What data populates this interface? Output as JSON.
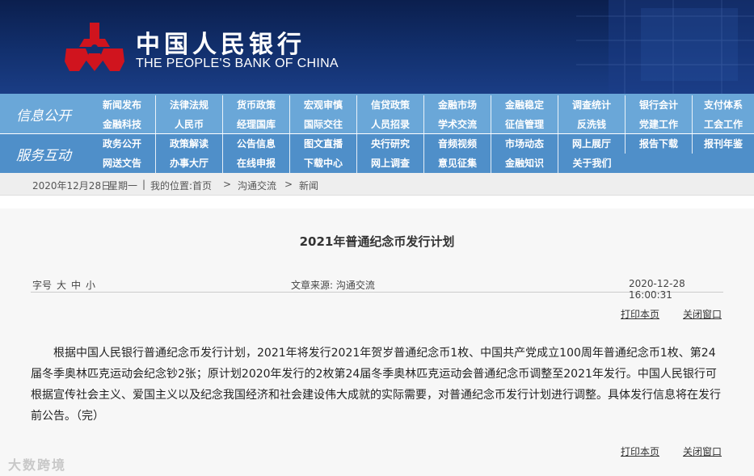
{
  "header": {
    "bank_name_cn": "中国人民银行",
    "bank_name_en": "THE PEOPLE'S BANK OF CHINA",
    "logo_icon": "pboc-logo-icon",
    "colors": {
      "banner": "#12306e",
      "logo": "#d0141e"
    }
  },
  "nav": {
    "info_title": "信息公开",
    "service_title": "服务互动",
    "info_row1": [
      "新闻发布",
      "法律法规",
      "货币政策",
      "宏观审慎",
      "信贷政策",
      "金融市场",
      "金融稳定",
      "调查统计",
      "银行会计",
      "支付体系"
    ],
    "info_row2": [
      "金融科技",
      "人民币",
      "经理国库",
      "国际交往",
      "人员招录",
      "学术交流",
      "征信管理",
      "反洗钱",
      "党建工作",
      "工会工作"
    ],
    "service_row1": [
      "政务公开",
      "政策解读",
      "公告信息",
      "图文直播",
      "央行研究",
      "音频视频",
      "市场动态",
      "网上展厅",
      "报告下载",
      "报刊年鉴"
    ],
    "service_row2": [
      "网送文告",
      "办事大厅",
      "在线申报",
      "下载中心",
      "网上调查",
      "意见征集",
      "金融知识",
      "关于我们"
    ],
    "colors": {
      "info_bg": "#6aa7d8",
      "service_bg": "#4f8fc9"
    }
  },
  "breadcrumb": {
    "date": "2020年12月28日",
    "weekday": "星期一",
    "separator": "|",
    "location_label": "我的位置:",
    "home": "首页",
    "arrow": ">",
    "level1": "沟通交流",
    "level2": "新闻"
  },
  "article": {
    "title": "2021年普通纪念币发行计划",
    "font_size_label": "字号",
    "font_size_options": [
      "大",
      "中",
      "小"
    ],
    "source": "文章来源: 沟通交流",
    "timestamp": "2020-12-28 16:00:31",
    "print_label": "打印本页",
    "close_label": "关闭窗口",
    "body": "根据中国人民银行普通纪念币发行计划，2021年将发行2021年贺岁普通纪念币1枚、中国共产党成立100周年普通纪念币1枚、第24届冬季奥林匹克运动会纪念钞2张；原计划2020年发行的2枚第24届冬季奥林匹克运动会普通纪念币调整至2021年发行。中国人民银行可根据宣传社会主义、爱国主义以及纪念我国经济和社会建设伟大成就的实际需要，对普通纪念币发行计划进行调整。具体发行信息将在发行前公告。（完）"
  },
  "watermark": "大数跨境"
}
